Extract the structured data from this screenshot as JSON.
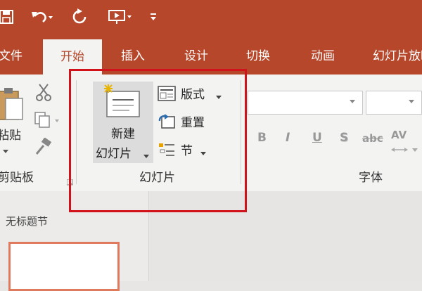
{
  "app": {
    "accent_color": "#b7472a",
    "ribbon_color": "#f3f3f2",
    "highlight_color": "#d1121b"
  },
  "qat": {
    "save_icon": "save-icon",
    "undo_icon": "undo-icon",
    "redo_icon": "repeat-icon",
    "present_icon": "present-from-start-icon",
    "customize_icon": "customize-qat-icon"
  },
  "tabs": [
    "文件",
    "开始",
    "插入",
    "设计",
    "切换",
    "动画",
    "幻灯片放映"
  ],
  "clipboard": {
    "paste_label": "粘贴",
    "group_label": "剪贴板"
  },
  "slides": {
    "new_slide_label_line1": "新建",
    "new_slide_label_line2": "幻灯片",
    "layout_label": "版式",
    "reset_label": "重置",
    "section_label": "节",
    "group_label": "幻灯片"
  },
  "font": {
    "group_label": "字体",
    "bold": "B",
    "italic": "I",
    "underline": "U",
    "strike": "S",
    "abc": "abc",
    "spacing": "AV"
  },
  "thumbnails": {
    "section_title": "无标题节"
  }
}
